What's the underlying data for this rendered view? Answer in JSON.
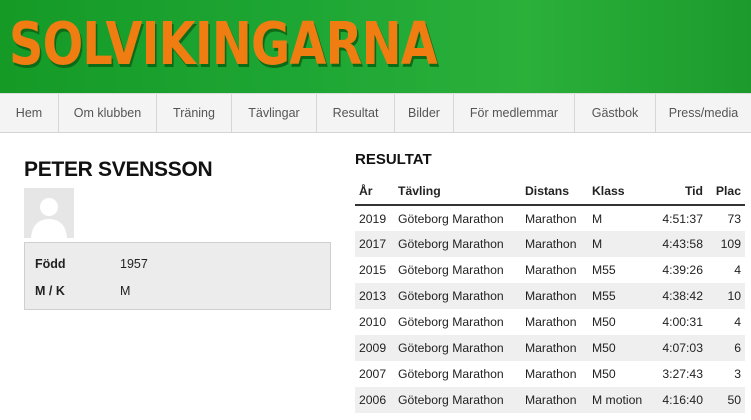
{
  "site": {
    "title": "SOLVIKINGARNA"
  },
  "nav": {
    "items": [
      {
        "label": "Hem"
      },
      {
        "label": "Om klubben"
      },
      {
        "label": "Träning"
      },
      {
        "label": "Tävlingar"
      },
      {
        "label": "Resultat"
      },
      {
        "label": "Bilder"
      },
      {
        "label": "För medlemmar"
      },
      {
        "label": "Gästbok"
      },
      {
        "label": "Press/media"
      }
    ]
  },
  "profile": {
    "name": "PETER SVENSSON",
    "avatar_icon": "person-silhouette-icon",
    "fields": [
      {
        "label": "Född",
        "value": "1957"
      },
      {
        "label": "M / K",
        "value": "M"
      }
    ]
  },
  "results": {
    "title": "RESULTAT",
    "columns": [
      "År",
      "Tävling",
      "Distans",
      "Klass",
      "Tid",
      "Plac"
    ],
    "rows": [
      [
        "2019",
        "Göteborg Marathon",
        "Marathon",
        "M",
        "4:51:37",
        "73"
      ],
      [
        "2017",
        "Göteborg Marathon",
        "Marathon",
        "M",
        "4:43:58",
        "109"
      ],
      [
        "2015",
        "Göteborg Marathon",
        "Marathon",
        "M55",
        "4:39:26",
        "4"
      ],
      [
        "2013",
        "Göteborg Marathon",
        "Marathon",
        "M55",
        "4:38:42",
        "10"
      ],
      [
        "2010",
        "Göteborg Marathon",
        "Marathon",
        "M50",
        "4:00:31",
        "4"
      ],
      [
        "2009",
        "Göteborg Marathon",
        "Marathon",
        "M50",
        "4:07:03",
        "6"
      ],
      [
        "2007",
        "Göteborg Marathon",
        "Marathon",
        "M50",
        "3:27:43",
        "3"
      ],
      [
        "2006",
        "Göteborg Marathon",
        "Marathon",
        "M motion",
        "4:16:40",
        "50"
      ]
    ]
  },
  "colors": {
    "banner_green": "#1ea634",
    "logo_orange": "#f07d11",
    "nav_bg": "#f4f4f4"
  }
}
